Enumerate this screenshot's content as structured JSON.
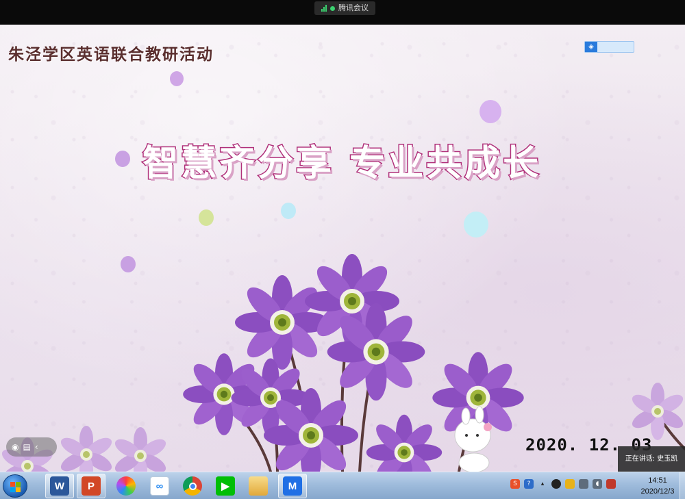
{
  "meeting_bar": {
    "app_name": "腾讯会议"
  },
  "slide": {
    "org_title": "朱泾学区英语联合教研活动",
    "main_title": "智慧齐分享 专业共成长",
    "date": "2020. 12. 03"
  },
  "speaking_indicator": "正在讲话: 史玉凯",
  "taskbar": {
    "apps": [
      {
        "name": "word",
        "glyph": "W",
        "color": "#2b579a",
        "active": true
      },
      {
        "name": "powerpoint",
        "glyph": "P",
        "color": "#d24726",
        "active": true
      },
      {
        "name": "picture-viewer",
        "glyph": "",
        "color": "#ff8a00",
        "active": false
      },
      {
        "name": "baidu-netdisk",
        "glyph": "",
        "color": "#2a8cf2",
        "active": false
      },
      {
        "name": "chrome",
        "glyph": "",
        "color": "#db4437",
        "active": false
      },
      {
        "name": "iqiyi",
        "glyph": "",
        "color": "#00be06",
        "active": false
      },
      {
        "name": "file-explorer",
        "glyph": "",
        "color": "#e9b94a",
        "active": false
      },
      {
        "name": "tencent-meeting",
        "glyph": "",
        "color": "#1f6fe5",
        "active": true
      }
    ],
    "clock_time": "14:51",
    "clock_date": "2020/12/3"
  }
}
